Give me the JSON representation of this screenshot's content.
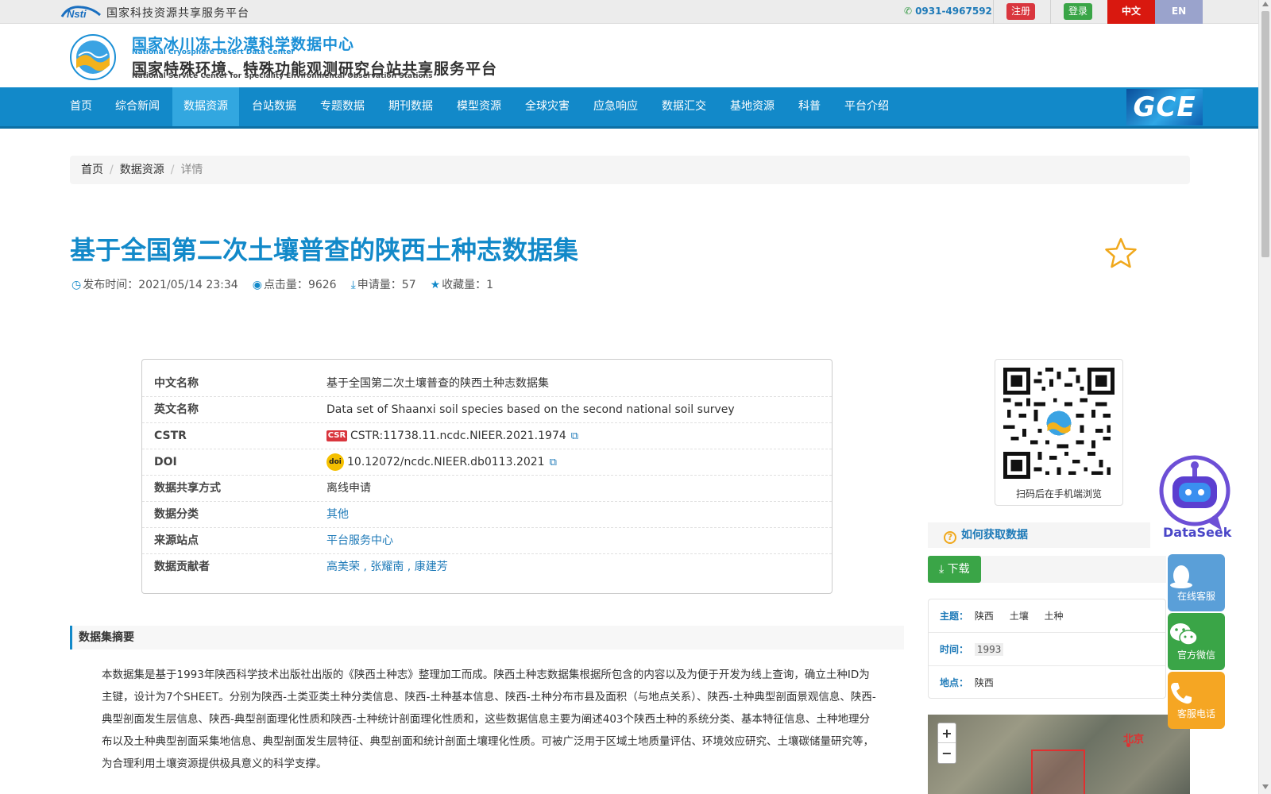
{
  "topbar": {
    "platform": "国家科技资源共享服务平台",
    "phone": "0931-4967592",
    "register": "注册",
    "login": "登录",
    "lang_zh": "中文",
    "lang_en": "EN"
  },
  "brand": {
    "cn1": "国家冰川冻土沙漠科学数据中心",
    "en1": "National Cryosphere Desert Data Center",
    "cn2": "国家特殊环境、特殊功能观测研究台站共享服务平台",
    "en2": "National Service Center for Speciality Environmental Observation Stations",
    "gce": "GCE"
  },
  "nav": {
    "items": [
      "首页",
      "综合新闻",
      "数据资源",
      "台站数据",
      "专题数据",
      "期刊数据",
      "模型资源",
      "全球灾害",
      "应急响应",
      "数据汇交",
      "基地资源",
      "科普",
      "平台介绍"
    ],
    "active_index": 2
  },
  "breadcrumb": {
    "home": "首页",
    "section": "数据资源",
    "current": "详情"
  },
  "dataset": {
    "title": "基于全国第二次土壤普查的陕西土种志数据集",
    "publish_label": "发布时间：",
    "publish_time": "2021/05/14 23:34",
    "views_label": "点击量：",
    "views": "9626",
    "requests_label": "申请量：",
    "requests": "57",
    "favorites_label": "收藏量：",
    "favorites": "1"
  },
  "info": {
    "cn_name_key": "中文名称",
    "cn_name": "基于全国第二次土壤普查的陕西土种志数据集",
    "en_name_key": "英文名称",
    "en_name": "Data set of Shaanxi soil species based on the second national soil survey",
    "cstr_key": "CSTR",
    "cstr_logo": "CSR",
    "cstr": "CSTR:11738.11.ncdc.NIEER.2021.1974",
    "doi_key": "DOI",
    "doi_logo": "doi",
    "doi": "10.12072/ncdc.NIEER.db0113.2021",
    "share_key": "数据共享方式",
    "share": "离线申请",
    "category_key": "数据分类",
    "category": "其他",
    "station_key": "来源站点",
    "station": "平台服务中心",
    "contributors_key": "数据贡献者",
    "contributors": "高美荣 , 张耀南 , 康建芳"
  },
  "summary": {
    "heading": "数据集摘要",
    "text": "本数据集是基于1993年陕西科学技术出版社出版的《陕西土种志》整理加工而成。陕西土种志数据集根据所包含的内容以及为便于开发为线上查询，确立土种ID为主键，设计为7个SHEET。分别为陕西-土类亚类土种分类信息、陕西-土种基本信息、陕西-土种分布市县及面积（与地点关系）、陕西-土种典型剖面景观信息、陕西-典型剖面发生层信息、陕西-典型剖面理化性质和陕西-土种统计剖面理化性质和，这些数据信息主要为阐述403个陕西土种的系统分类、基本特征信息、土种地理分布以及土种典型剖面采集地信息、典型剖面发生层特征、典型剖面和统计剖面土壤理化性质。可被广泛用于区域土地质量评估、环境效应研究、土壤碳储量研究等，为合理利用土壤资源提供极具意义的科学支撑。"
  },
  "sidebar": {
    "qr_caption": "扫码后在手机端浏览",
    "how_to": "如何获取数据",
    "download": "下载",
    "theme_key": "主题：",
    "themes": [
      "陕西",
      "土壤",
      "土种"
    ],
    "time_key": "时间：",
    "time": "1993",
    "place_key": "地点：",
    "place": "陕西",
    "map_label": "北京",
    "zoom_in": "+",
    "zoom_out": "−"
  },
  "floating": {
    "dataseek": "DataSeek",
    "online_service": "在线客服",
    "wechat": "官方微信",
    "phone": "客服电话"
  },
  "colors": {
    "primary": "#1289c9",
    "nav_active": "#32a7e0",
    "green": "#3aa547",
    "red": "#d9363e",
    "orange": "#f5a623"
  }
}
